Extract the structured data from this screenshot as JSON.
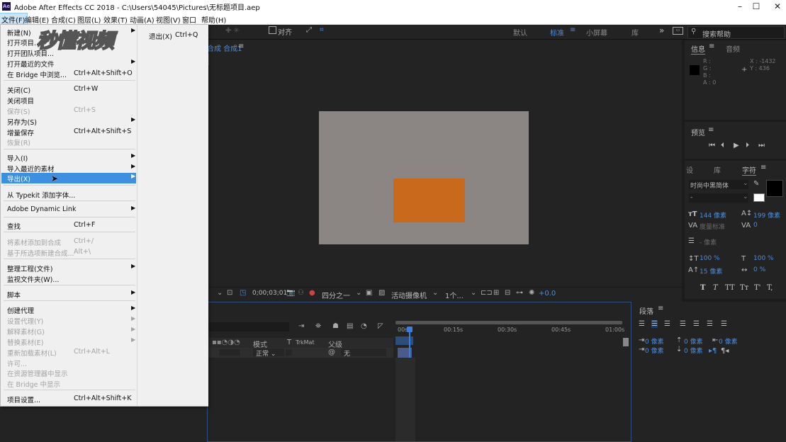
{
  "title_bar": {
    "logo": "Ae",
    "title": "Adobe After Effects CC 2018 - C:\\Users\\54045\\Pictures\\无标题项目.aep",
    "controls": [
      "–",
      "☐",
      "✕"
    ]
  },
  "menubar": [
    "文件(F)",
    "编辑(E)",
    "合成(C)",
    "图层(L)",
    "效果(T)",
    "动画(A)",
    "视图(V)",
    "窗口",
    "帮助(H)"
  ],
  "toolbar": {
    "snap_label": "对齐",
    "workspaces": [
      "默认",
      "标准",
      "小屏幕",
      "库"
    ],
    "active_workspace": "标准",
    "more": "»",
    "search_placeholder": "搜索帮助"
  },
  "watermark": "秒懂视频",
  "file_menu": {
    "items": [
      {
        "label": "新建(N)",
        "shortcut": "",
        "arrow": true
      },
      {
        "label": "打开项目...",
        "shortcut": "",
        "arrow": false
      },
      {
        "label": "打开团队项目...",
        "shortcut": "",
        "arrow": false
      },
      {
        "label": "打开最近的文件",
        "shortcut": "",
        "arrow": true
      },
      {
        "label": "在 Bridge 中浏览...",
        "shortcut": "Ctrl+Alt+Shift+O",
        "arrow": false
      },
      {
        "label": "关闭(C)",
        "shortcut": "Ctrl+W",
        "arrow": false
      },
      {
        "label": "关闭项目",
        "shortcut": "",
        "arrow": false
      },
      {
        "label": "保存(S)",
        "shortcut": "Ctrl+S",
        "arrow": false,
        "disabled": true
      },
      {
        "label": "另存为(S)",
        "shortcut": "",
        "arrow": true
      },
      {
        "label": "增量保存",
        "shortcut": "Ctrl+Alt+Shift+S",
        "arrow": false
      },
      {
        "label": "恢复(R)",
        "shortcut": "",
        "arrow": false,
        "disabled": true
      },
      {
        "label": "导入(I)",
        "shortcut": "",
        "arrow": true
      },
      {
        "label": "导入最近的素材",
        "shortcut": "",
        "arrow": true
      },
      {
        "label": "导出(X)",
        "shortcut": "",
        "arrow": true,
        "highlighted": true
      },
      {
        "label": "从 Typekit 添加字体...",
        "shortcut": "",
        "arrow": false
      },
      {
        "label": "Adobe Dynamic Link",
        "shortcut": "",
        "arrow": true
      },
      {
        "label": "查找",
        "shortcut": "Ctrl+F",
        "arrow": false
      },
      {
        "label": "将素材添加到合成",
        "shortcut": "Ctrl+/",
        "arrow": false,
        "disabled": true
      },
      {
        "label": "基于所选项新建合成...",
        "shortcut": "Alt+\\",
        "arrow": false,
        "disabled": true
      },
      {
        "label": "整理工程(文件)",
        "shortcut": "",
        "arrow": true
      },
      {
        "label": "监视文件夹(W)...",
        "shortcut": "",
        "arrow": false
      },
      {
        "label": "脚本",
        "shortcut": "",
        "arrow": true
      },
      {
        "label": "创建代理",
        "shortcut": "",
        "arrow": true
      },
      {
        "label": "设置代理(Y)",
        "shortcut": "",
        "arrow": true,
        "disabled": true
      },
      {
        "label": "解释素材(G)",
        "shortcut": "",
        "arrow": true,
        "disabled": true
      },
      {
        "label": "替换素材(E)",
        "shortcut": "",
        "arrow": true,
        "disabled": true
      },
      {
        "label": "重新加载素材(L)",
        "shortcut": "Ctrl+Alt+L",
        "arrow": false,
        "disabled": true
      },
      {
        "label": "许可...",
        "shortcut": "",
        "arrow": false,
        "disabled": true
      },
      {
        "label": "在资源管理器中显示",
        "shortcut": "",
        "arrow": false,
        "disabled": true
      },
      {
        "label": "在 Bridge 中显示",
        "shortcut": "",
        "arrow": false,
        "disabled": true
      },
      {
        "label": "项目设置...",
        "shortcut": "Ctrl+Alt+Shift+K",
        "arrow": false
      }
    ],
    "exit_label": "退出(X)",
    "exit_shortcut": "Ctrl+Q"
  },
  "comp_panel": {
    "tab_label": "合成 合成1",
    "timecode": "0;00;03;01",
    "resolution": "四分之一",
    "camera": "活动摄像机",
    "views": "1个...",
    "exposure": "+0.0",
    "colors": {
      "background": "#8b8584",
      "shape": "#c8691b"
    }
  },
  "timeline": {
    "ruler": [
      "00s",
      "00:15s",
      "00:30s",
      "00:45s",
      "01:00s"
    ],
    "columns": {
      "mode": "模式",
      "t": "T",
      "trkmat": "TrkMat",
      "parent": "父级"
    },
    "layer": {
      "mode": "正常",
      "parent": "无"
    }
  },
  "info_panel": {
    "tabs": [
      "信息",
      "音频"
    ],
    "channels": [
      "R :",
      "G :",
      "B :",
      "A : 0"
    ],
    "x": "X : -1432",
    "y": "Y : 436"
  },
  "preview_panel": {
    "title": "预览"
  },
  "character_panel": {
    "tabs": [
      "设",
      "库",
      "字符"
    ],
    "font": "时尚中黑简体",
    "style": "-",
    "size": "144 像素",
    "leading": "199 像素",
    "kerning": "度量标准",
    "tracking": "0",
    "stroke": "- 像素",
    "vscale": "100 %",
    "hscale": "100 %",
    "baseline": "15 像素",
    "tsume": "0 %",
    "styles": [
      "T",
      "T",
      "TT",
      "Tт",
      "T'",
      "T,"
    ]
  },
  "paragraph_panel": {
    "title": "段落",
    "indent_left": "0 像素",
    "indent_first": "0 像素",
    "space_before": "0 像素",
    "indent_right": "0 像素",
    "space_after": "0 像素"
  }
}
